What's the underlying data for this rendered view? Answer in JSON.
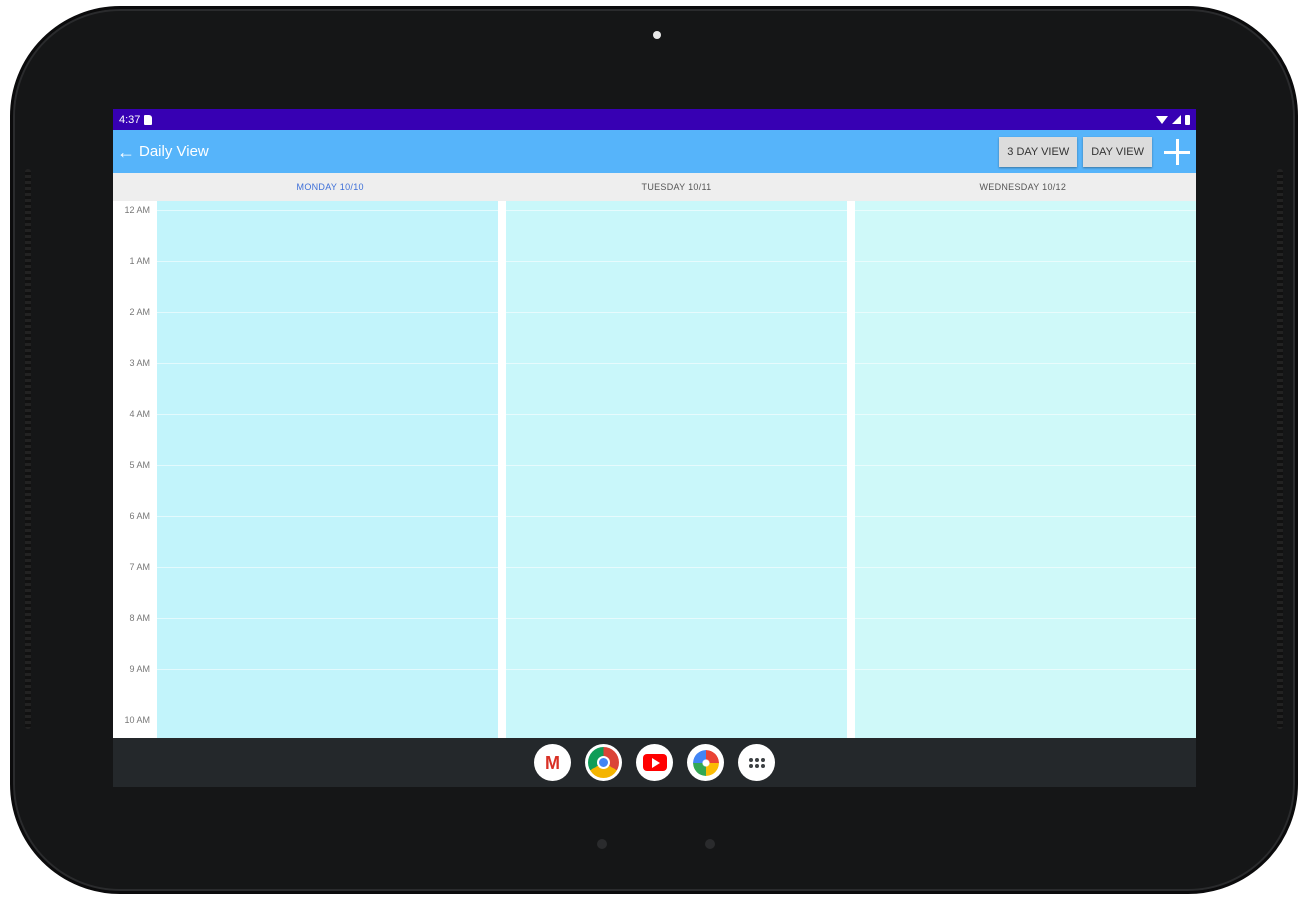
{
  "status_bar": {
    "time": "4:37"
  },
  "app_bar": {
    "back_glyph": "←",
    "title": "Daily View",
    "three_day_label": "3 DAY VIEW",
    "day_label": "DAY VIEW"
  },
  "days": [
    {
      "label": "MONDAY 10/10",
      "color": "#c2f4fb",
      "today": true
    },
    {
      "label": "TUESDAY 10/11",
      "color": "#c9f7fa",
      "today": false
    },
    {
      "label": "WEDNESDAY 10/12",
      "color": "#cff9f9",
      "today": false
    }
  ],
  "hours": [
    "12 AM",
    "1 AM",
    "2 AM",
    "3 AM",
    "4 AM",
    "5 AM",
    "6 AM",
    "7 AM",
    "8 AM",
    "9 AM",
    "10 AM"
  ],
  "colors": {
    "status_bar": "#3700b3",
    "app_bar": "#56b4fa",
    "today_header": "#3d6fd8",
    "dock": "#24282b"
  },
  "dock": {
    "apps": [
      "gmail-icon",
      "chrome-icon",
      "youtube-icon",
      "photos-icon",
      "app-drawer-icon"
    ],
    "gmail_glyph": "M"
  }
}
